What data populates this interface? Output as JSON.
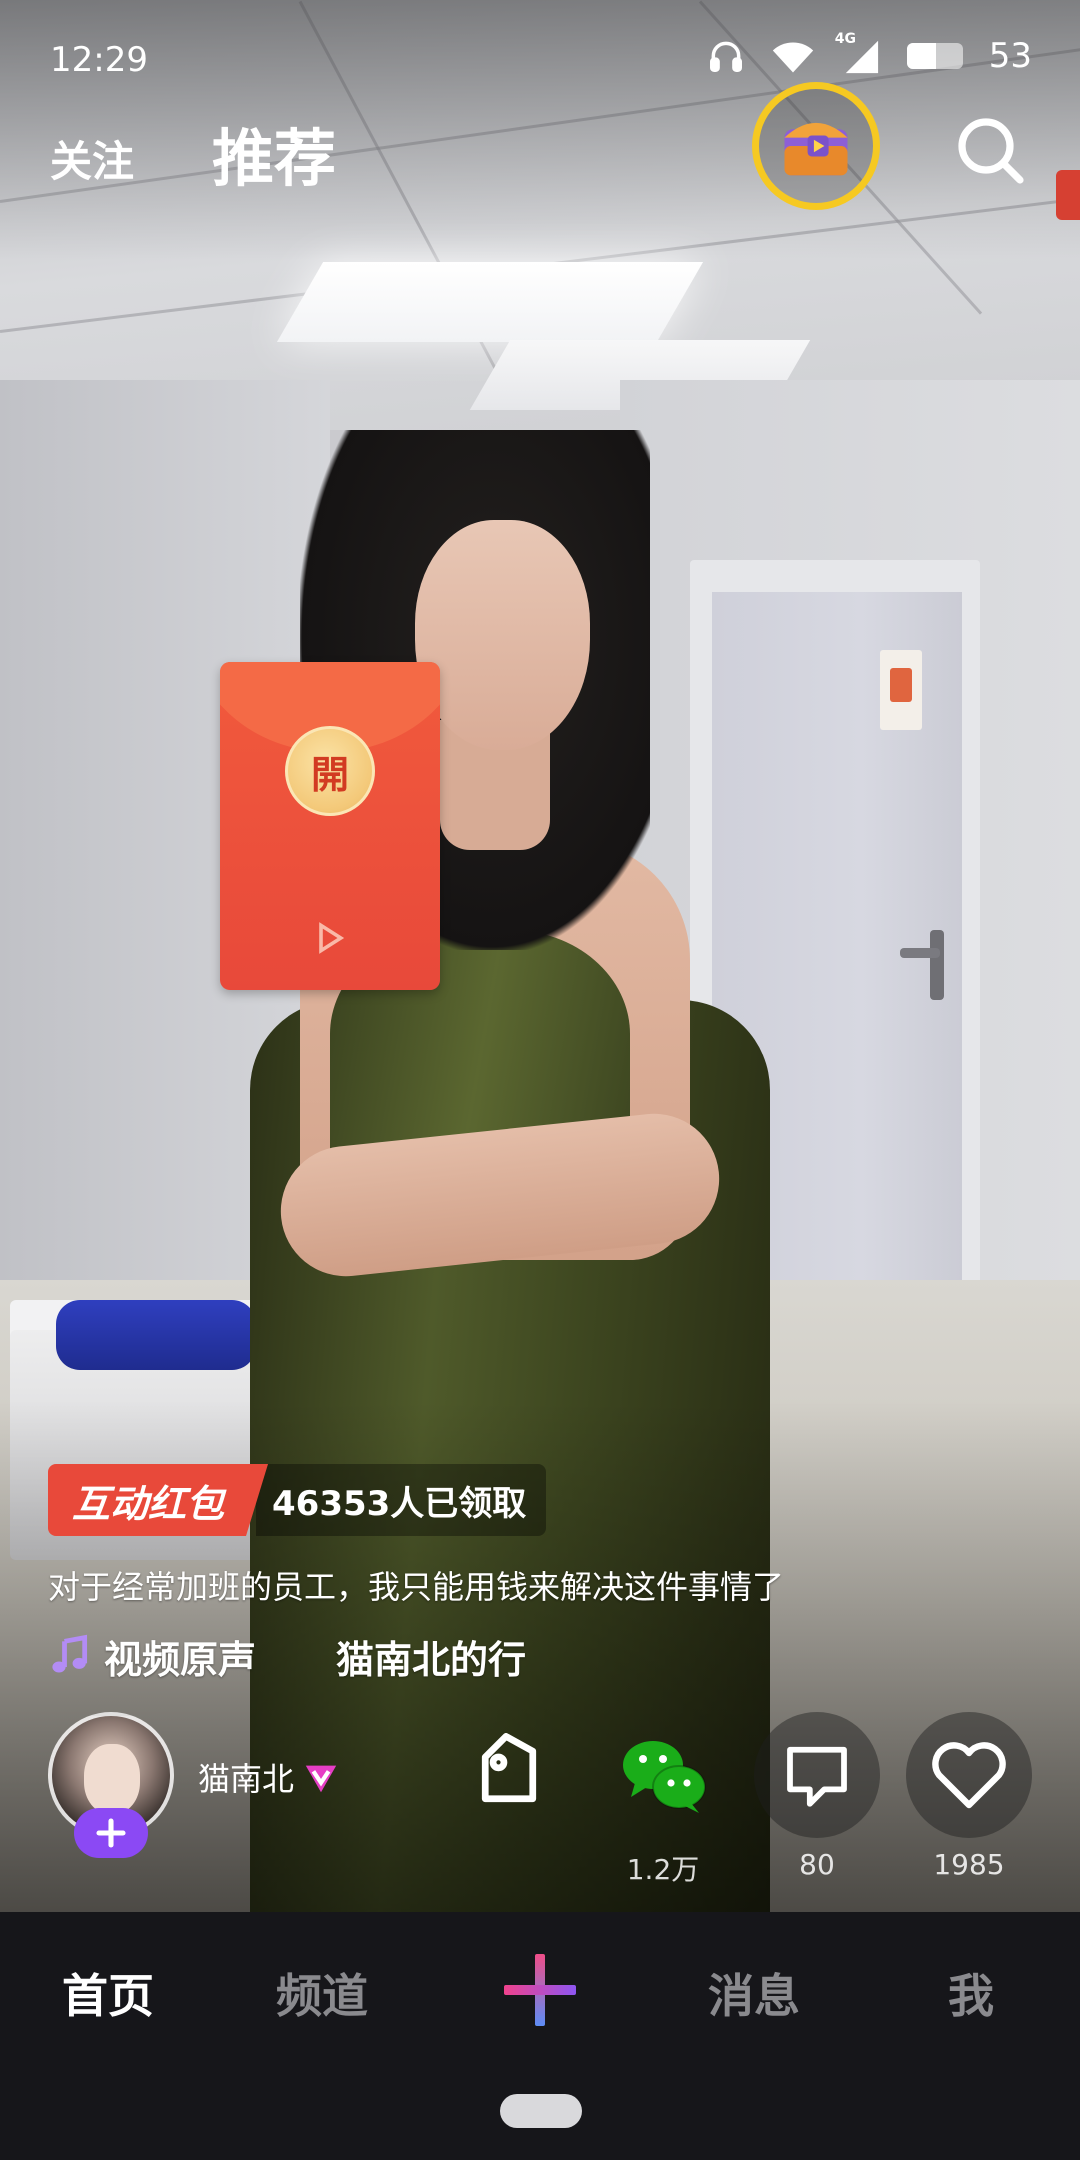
{
  "status_bar": {
    "time": "12:29",
    "network": "4G",
    "battery": "53",
    "battery_level": 0.53
  },
  "top_nav": {
    "follow_label": "关注",
    "recommend_label": "推荐",
    "treasure_icon": "treasure-chest-icon",
    "search_icon": "search-icon"
  },
  "envelope": {
    "open_char": "開"
  },
  "video_info": {
    "red_packet_tag": "互动红包",
    "red_packet_count": "46353人已领取",
    "caption": "对于经常加班的员工，我只能用钱来解决这件事情了",
    "music_label": "视频原声",
    "music_scroll": "猫南北的行",
    "author_name": "猫南北"
  },
  "actions": {
    "wechat_count": "1.2万",
    "comment_count": "80",
    "like_count": "1985"
  },
  "tabbar": {
    "home": "首页",
    "channel": "频道",
    "messages": "消息",
    "me": "我"
  },
  "colors": {
    "accent_purple": "#8b49f4",
    "red_packet": "#e8493a",
    "treasure_ring": "#f6c922",
    "wechat_green": "#1aad19",
    "tabbar_bg": "#16161a"
  }
}
